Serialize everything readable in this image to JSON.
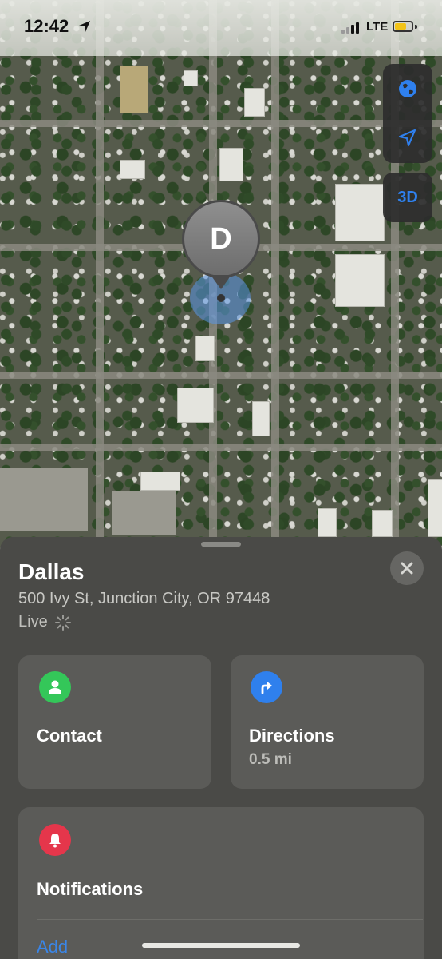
{
  "status_bar": {
    "time": "12:42",
    "network": "LTE",
    "battery_level": 0.7
  },
  "map_controls": {
    "three_d_label": "3D"
  },
  "pin": {
    "initial": "D"
  },
  "sheet": {
    "title": "Dallas",
    "address": "500 Ivy St, Junction City, OR  97448",
    "status": "Live"
  },
  "actions": {
    "contact": {
      "label": "Contact"
    },
    "directions": {
      "label": "Directions",
      "distance": "0.5 mi"
    }
  },
  "notifications": {
    "label": "Notifications",
    "add_label": "Add"
  },
  "colors": {
    "contact_green": "#34c759",
    "directions_blue": "#2f80ed",
    "notify_red": "#e5364b",
    "link_blue": "#3a86e8"
  }
}
